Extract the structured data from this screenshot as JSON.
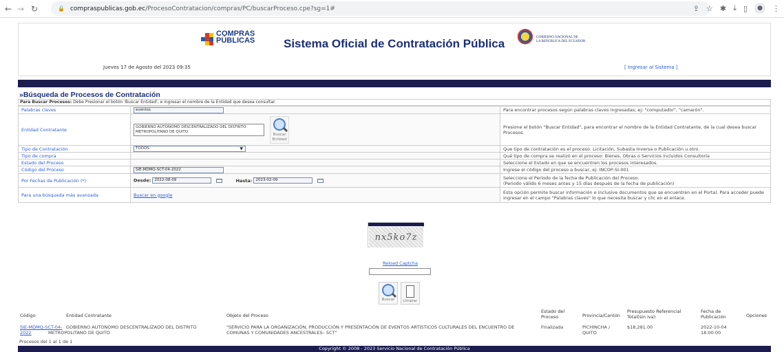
{
  "browser": {
    "url_host": "compraspublicas.gob.ec",
    "url_path": "/ProcesoContratacion/compras/PC/buscarProceso.cpe?sg=1#"
  },
  "header": {
    "logo_compras": "COMPRAS PÚBLICAS",
    "title": "Sistema Oficial de Contratación Pública",
    "gob_text_1": "GOBIERNO NACIONAL DE",
    "gob_text_2": "LA REPUBLICA DEL ECUADOR",
    "date": "Jueves 17 de Agosto del 2023 09:35",
    "login": "[ Ingresar al Sistema ]"
  },
  "section_title": "»Búsqueda de Procesos de Contratación",
  "instructions": {
    "bold": "Para Buscar Procesos:",
    "text": " Debe Presionar el botón 'Buscar Entidad', e ingresar el nombre de la Entidad que desea consultar."
  },
  "form": {
    "keywords": {
      "label": "Palabras claves",
      "value": "eventos",
      "help": "Para encontrar procesos según palabras claves ingresadas; ej: \"computador\", \"camarón\"."
    },
    "entity": {
      "label": "Entidad Contratante",
      "value": "GOBIERNO AUTONOMO DESCENTRALIZADO DEL DISTRITO METROPOLITANO DE QUITO",
      "button": "Buscar Entidad",
      "help": "Presione el botón \"Buscar Entidad\", para encontrar el nombre de la Entidad Contratante, de la cual desea buscar Procesos."
    },
    "type": {
      "label": "Tipo de Contratación",
      "value": "TODOS",
      "help": "Que tipo de contratación es el proceso: Licitación, Subasta Inversa o Publicación u otro."
    },
    "purchase": {
      "label": "Tipo de compra",
      "help": "Qué tipo de compra se realizó en el proceso: Bienes, Obras o Servicios incluidos Consultoría"
    },
    "status": {
      "label": "Estado del Proceso",
      "help": "Seleccione el Estado en que se encuentren los procesos interesados."
    },
    "code": {
      "label": "Código del Proceso",
      "value": "SIE-MDMQ-SCT-04-2022",
      "help": "Ingrese el código del proceso a buscar, ej: INCOP-SI-001"
    },
    "dates": {
      "label": "Por Fechas de Publicación (*)",
      "from_label": "Desde:",
      "from_value": "2022-08-09",
      "to_label": "Hasta:",
      "to_value": "2023-02-09",
      "help_1": "Seleccione el Período de la fecha de Publicación del Proceso.",
      "help_2": "(Periodo válido 6 meses antes y 15 días después de la fecha de publicación)"
    },
    "advanced": {
      "label": "Para una búsqueda más avanzada",
      "link": "Buscar en google",
      "help": "Esta opción permite buscar información e inclusive documentos que se encuentren en el Portal. Para acceder puede ingresar en el campo \"Palabras claves\" lo que necesita buscar y clic en el enlace."
    }
  },
  "captcha": {
    "text": "nx5ko7z",
    "reload": "Reload Captcha",
    "search_btn": "Buscar",
    "clear_btn": "Limpiar"
  },
  "results": {
    "headers": [
      "Código",
      "Entidad Contratante",
      "Objeto del Proceso",
      "Estado del Proceso",
      "Provincia/Cantón",
      "Presupuesto Referencial Total(sin iva)",
      "Fecha de Publicación",
      "Opciones"
    ],
    "row": {
      "code": "SIE-MDMQ-SCT-04-2022",
      "entity": "GOBIERNO AUTONOMO DESCENTRALIZADO DEL DISTRITO METROPOLITANO DE QUITO",
      "object": "\"SERVICIO PARA LA ORGANIZACIÓN, PRODUCCIÓN Y PRESENTACIÓN DE EVENTOS ARTÍSTICOS CULTURALES DEL ENCUENTRO DE COMUNAS Y COMUNIDADES ANCESTRALES– SCT\"",
      "status": "Finalizada",
      "province": "PICHINCHA / QUITO",
      "budget": "$18,281.00",
      "date": "2022-10-04 18:00:00"
    },
    "count": "Procesos del 1 al 1 de 1"
  },
  "footer": "Copyright © 2008 - 2023 Servicio Nacional de Contratación Pública"
}
